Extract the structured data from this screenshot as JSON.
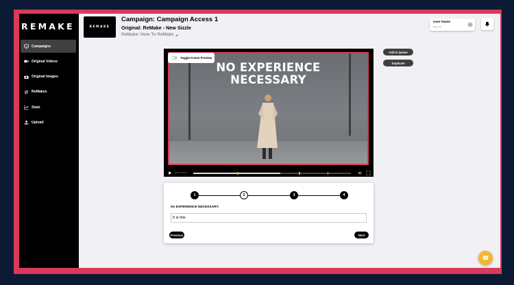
{
  "brand": {
    "logo": "REMAKE",
    "thumb_logo": "REMAKE",
    "accent": "#d83a5a"
  },
  "sidebar": {
    "items": [
      {
        "label": "Campaigns",
        "icon": "monitor-icon",
        "active": true
      },
      {
        "label": "Original Videos",
        "icon": "video-camera-icon",
        "active": false
      },
      {
        "label": "Original Images",
        "icon": "camera-icon",
        "active": false
      },
      {
        "label": "ReMakes",
        "icon": "swap-icon",
        "active": false
      },
      {
        "label": "Stats",
        "icon": "chart-icon",
        "active": false
      },
      {
        "label": "Upload",
        "icon": "upload-icon",
        "active": false
      }
    ]
  },
  "header": {
    "title": "Campaign: Campaign Access 1",
    "original": "Original: ReMake - New Sizzle",
    "link": "ReMake: How To ReMake"
  },
  "user": {
    "name": "User Name",
    "subtitle": "Dear Jon"
  },
  "video": {
    "toggle_label": "Toggle Frame Preview",
    "headline_line1": "NO EXPERIENCE",
    "headline_line2": "NECESSARY",
    "time": "00:00 / 00:16",
    "progress": 0.55
  },
  "actions": {
    "add_to_queue": "Add to Queue",
    "duplicate": "Duplicate"
  },
  "stepper": {
    "steps": [
      "1",
      "2",
      "3",
      "4"
    ],
    "current": 2,
    "field_label": "No EXPERIENCE NECESSARY:",
    "field_value": "It is this",
    "previous": "Previous",
    "next": "Next"
  }
}
